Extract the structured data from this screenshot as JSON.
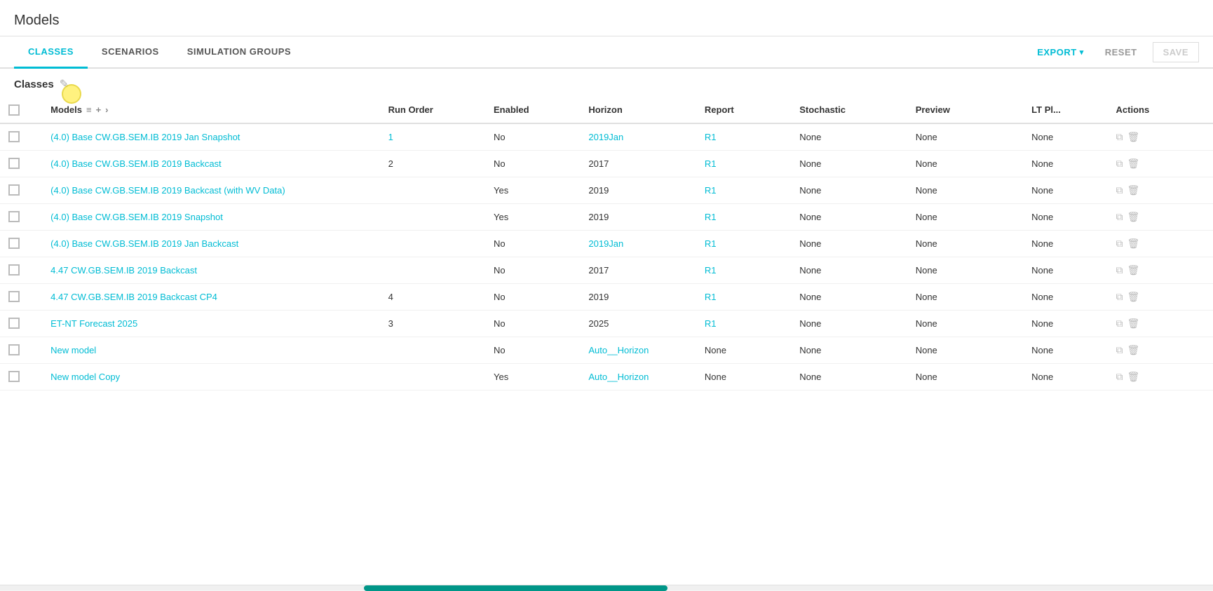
{
  "page": {
    "title": "Models"
  },
  "tabs": {
    "items": [
      {
        "id": "classes",
        "label": "CLASSES",
        "active": true
      },
      {
        "id": "scenarios",
        "label": "SCENARIOS",
        "active": false
      },
      {
        "id": "simulation-groups",
        "label": "SIMULATION GROUPS",
        "active": false
      }
    ],
    "export_label": "EXPORT",
    "reset_label": "RESET",
    "save_label": "SAVE"
  },
  "section": {
    "title": "Classes"
  },
  "table": {
    "columns": [
      {
        "id": "check",
        "label": ""
      },
      {
        "id": "models",
        "label": "Models"
      },
      {
        "id": "run_order",
        "label": "Run Order"
      },
      {
        "id": "enabled",
        "label": "Enabled"
      },
      {
        "id": "horizon",
        "label": "Horizon"
      },
      {
        "id": "report",
        "label": "Report"
      },
      {
        "id": "stochastic",
        "label": "Stochastic"
      },
      {
        "id": "preview",
        "label": "Preview"
      },
      {
        "id": "lt_pl",
        "label": "LT Pl..."
      },
      {
        "id": "actions",
        "label": "Actions"
      }
    ],
    "rows": [
      {
        "id": 1,
        "name": "(4.0) Base CW.GB.SEM.IB 2019 Jan Snapshot",
        "run_order": "1",
        "run_order_linked": true,
        "enabled": "No",
        "horizon": "2019Jan",
        "horizon_linked": true,
        "report": "R1",
        "report_linked": true,
        "stochastic": "None",
        "preview": "None",
        "lt_pl": "None"
      },
      {
        "id": 2,
        "name": "(4.0) Base CW.GB.SEM.IB 2019 Backcast",
        "run_order": "2",
        "run_order_linked": false,
        "enabled": "No",
        "horizon": "2017",
        "horizon_linked": false,
        "report": "R1",
        "report_linked": false,
        "stochastic": "None",
        "preview": "None",
        "lt_pl": "None"
      },
      {
        "id": 3,
        "name": "(4.0) Base CW.GB.SEM.IB 2019 Backcast (with WV Data)",
        "run_order": "",
        "run_order_linked": false,
        "enabled": "Yes",
        "horizon": "2019",
        "horizon_linked": false,
        "report": "R1",
        "report_linked": false,
        "stochastic": "None",
        "preview": "None",
        "lt_pl": "None"
      },
      {
        "id": 4,
        "name": "(4.0) Base CW.GB.SEM.IB 2019 Snapshot",
        "run_order": "",
        "run_order_linked": false,
        "enabled": "Yes",
        "horizon": "2019",
        "horizon_linked": false,
        "report": "R1",
        "report_linked": false,
        "stochastic": "None",
        "preview": "None",
        "lt_pl": "None"
      },
      {
        "id": 5,
        "name": "(4.0) Base CW.GB.SEM.IB 2019 Jan Backcast",
        "run_order": "",
        "run_order_linked": false,
        "enabled": "No",
        "horizon": "2019Jan",
        "horizon_linked": true,
        "report": "R1",
        "report_linked": false,
        "stochastic": "None",
        "preview": "None",
        "lt_pl": "None"
      },
      {
        "id": 6,
        "name": "4.47 CW.GB.SEM.IB 2019 Backcast",
        "run_order": "",
        "run_order_linked": false,
        "enabled": "No",
        "horizon": "2017",
        "horizon_linked": false,
        "report": "R1",
        "report_linked": false,
        "stochastic": "None",
        "preview": "None",
        "lt_pl": "None"
      },
      {
        "id": 7,
        "name": "4.47 CW.GB.SEM.IB 2019 Backcast CP4",
        "run_order": "4",
        "run_order_linked": false,
        "enabled": "No",
        "horizon": "2019",
        "horizon_linked": false,
        "report": "R1",
        "report_linked": false,
        "stochastic": "None",
        "preview": "None",
        "lt_pl": "None"
      },
      {
        "id": 8,
        "name": "ET-NT Forecast 2025",
        "run_order": "3",
        "run_order_linked": false,
        "enabled": "No",
        "horizon": "2025",
        "horizon_linked": false,
        "report": "R1",
        "report_linked": false,
        "stochastic": "None",
        "preview": "None",
        "lt_pl": "None"
      },
      {
        "id": 9,
        "name": "New model",
        "run_order": "",
        "run_order_linked": false,
        "enabled": "No",
        "horizon": "Auto__Horizon",
        "horizon_auto": true,
        "report": "None",
        "report_linked": false,
        "report_none": true,
        "stochastic": "None",
        "preview": "None",
        "lt_pl": "None"
      },
      {
        "id": 10,
        "name": "New model Copy",
        "run_order": "",
        "run_order_linked": false,
        "enabled": "Yes",
        "horizon": "Auto__Horizon",
        "horizon_auto": true,
        "report": "None",
        "report_linked": false,
        "report_none": true,
        "stochastic": "None",
        "preview": "None",
        "lt_pl": "None"
      }
    ]
  },
  "icons": {
    "copy": "⧉",
    "delete": "🗑",
    "sort": "≡",
    "add": "+",
    "expand": "›",
    "rename": "✎",
    "chevron_down": "▾"
  },
  "colors": {
    "accent": "#00bcd4",
    "text_muted": "#999",
    "border": "#e0e0e0"
  }
}
